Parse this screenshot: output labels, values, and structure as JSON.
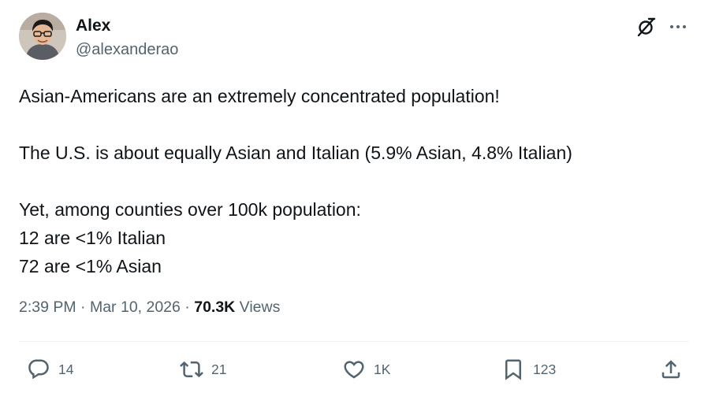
{
  "author": {
    "name": "Alex",
    "handle": "@alexanderao",
    "avatar_icon": "user-avatar-photo"
  },
  "header_actions": {
    "grok_icon": "grok-icon",
    "more_icon": "more-horizontal-icon"
  },
  "tweet": {
    "lines": [
      "Asian-Americans are an extremely concentrated population!",
      "",
      "The U.S. is about equally Asian and Italian (5.9% Asian, 4.8% Italian)",
      "",
      "Yet, among counties over 100k population:",
      "12 are <1% Italian",
      "72 are <1% Asian"
    ]
  },
  "meta": {
    "time": "2:39 PM",
    "separator": " · ",
    "date": "Mar 10, 2026",
    "views_count": "70.3K",
    "views_label": " Views"
  },
  "actions": {
    "reply": {
      "icon": "reply-icon",
      "count": "14"
    },
    "retweet": {
      "icon": "retweet-icon",
      "count": "21"
    },
    "like": {
      "icon": "heart-icon",
      "count": "1K"
    },
    "bookmark": {
      "icon": "bookmark-icon",
      "count": "123"
    },
    "share": {
      "icon": "share-icon"
    }
  },
  "colors": {
    "text": "#0f1419",
    "secondary": "#536471",
    "divider": "#eff3f4"
  }
}
